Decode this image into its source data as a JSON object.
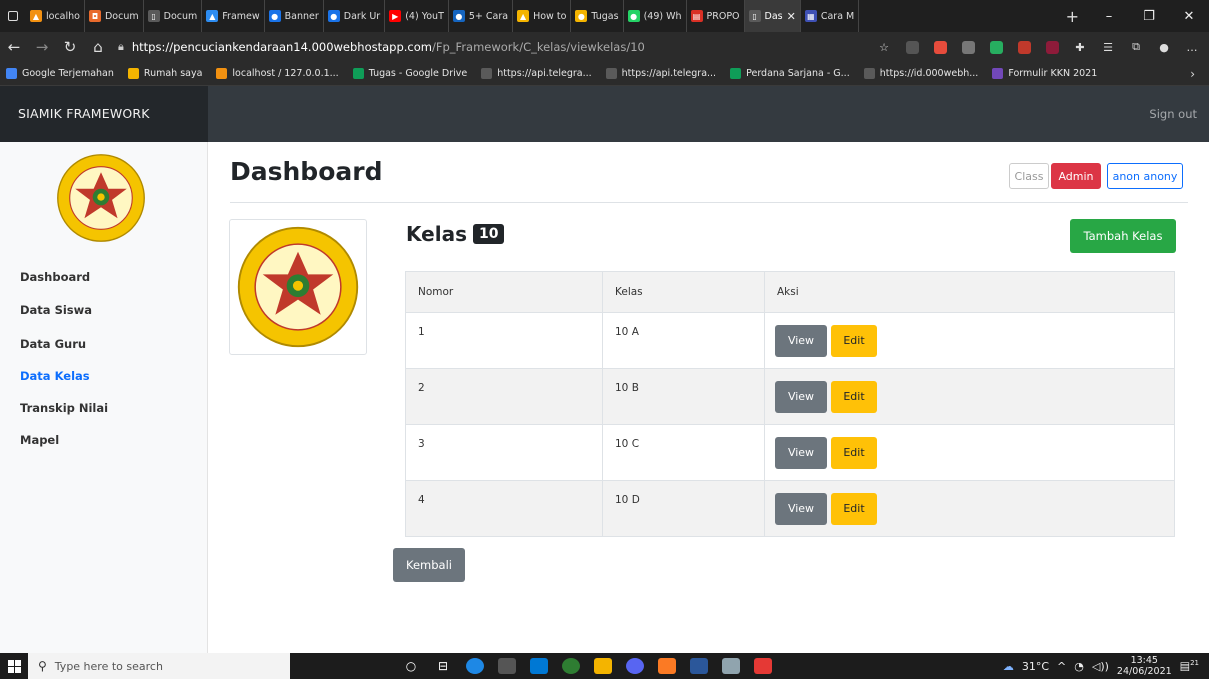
{
  "browser": {
    "tabs": [
      {
        "label": "localho",
        "color": "#f29111",
        "glyph": "▲"
      },
      {
        "label": "Docum",
        "color": "#e86a2c",
        "glyph": "◘"
      },
      {
        "label": "Docum",
        "color": "#5a5a5a",
        "glyph": "▯"
      },
      {
        "label": "Framew",
        "color": "#2d8cf0",
        "glyph": "▲"
      },
      {
        "label": "Banner",
        "color": "#1a73e8",
        "glyph": "●"
      },
      {
        "label": "Dark Ur",
        "color": "#1a73e8",
        "glyph": "●"
      },
      {
        "label": "(4) YouT",
        "color": "#ff0000",
        "glyph": "▶"
      },
      {
        "label": "5+ Cara",
        "color": "#1565c0",
        "glyph": "●"
      },
      {
        "label": "How to",
        "color": "#f4b400",
        "glyph": "▲"
      },
      {
        "label": "Tugas",
        "color": "#f4b400",
        "glyph": "●"
      },
      {
        "label": "(49) Wh",
        "color": "#25d366",
        "glyph": "●"
      },
      {
        "label": "PROPO",
        "color": "#d93025",
        "glyph": "▤"
      },
      {
        "label": "Das",
        "color": "#5a5a5a",
        "glyph": "▯",
        "active": true
      },
      {
        "label": "Cara M",
        "color": "#3f51b5",
        "glyph": "▦"
      }
    ],
    "url": {
      "host": "https://pencuciankendaraan14.000webhostapp.com",
      "path": "/Fp_Framework/C_kelas/viewkelas/10"
    },
    "bookmarks": [
      {
        "label": "Google Terjemahan",
        "color": "#4285f4"
      },
      {
        "label": "Rumah saya",
        "color": "#f4b400"
      },
      {
        "label": "localhost / 127.0.0.1...",
        "color": "#f29111"
      },
      {
        "label": "Tugas - Google Drive",
        "color": "#0f9d58"
      },
      {
        "label": "https://api.telegra...",
        "color": "#5a5a5a"
      },
      {
        "label": "https://api.telegra...",
        "color": "#5a5a5a"
      },
      {
        "label": "Perdana Sarjana - G...",
        "color": "#0f9d58"
      },
      {
        "label": "https://id.000webh...",
        "color": "#5a5a5a"
      },
      {
        "label": "Formulir KKN 2021",
        "color": "#7248b9"
      }
    ]
  },
  "app": {
    "brand": "SIAMIK FRAMEWORK",
    "sign_out": "Sign out",
    "sidebar": [
      {
        "label": "Dashboard",
        "active": false
      },
      {
        "label": "Data Siswa",
        "active": false
      },
      {
        "label": "Data Guru",
        "active": false
      },
      {
        "label": "Data Kelas",
        "active": true
      },
      {
        "label": "Transkip Nilai",
        "active": false
      },
      {
        "label": "Mapel",
        "active": false
      }
    ],
    "page_title": "Dashboard",
    "header_buttons": {
      "class": "Class",
      "admin": "Admin",
      "user": "anon anony"
    },
    "kelas_title": "Kelas",
    "kelas_badge": "10",
    "add_button": "Tambah Kelas",
    "table": {
      "headers": [
        "Nomor",
        "Kelas",
        "Aksi"
      ],
      "rows": [
        {
          "no": "1",
          "kelas": "10 A"
        },
        {
          "no": "2",
          "kelas": "10 B"
        },
        {
          "no": "3",
          "kelas": "10 C"
        },
        {
          "no": "4",
          "kelas": "10 D"
        }
      ],
      "view_label": "View",
      "edit_label": "Edit"
    },
    "back_button": "Kembali"
  },
  "taskbar": {
    "search_placeholder": "Type here to search",
    "weather": "31°C",
    "time": "13:45",
    "date": "24/06/2021",
    "notif_count": "21"
  },
  "colors": {
    "navbar": "#343a40",
    "active_link": "#0d6efd",
    "admin": "#dc3545",
    "add": "#28a745",
    "view": "#6c757d",
    "edit": "#ffc107"
  }
}
